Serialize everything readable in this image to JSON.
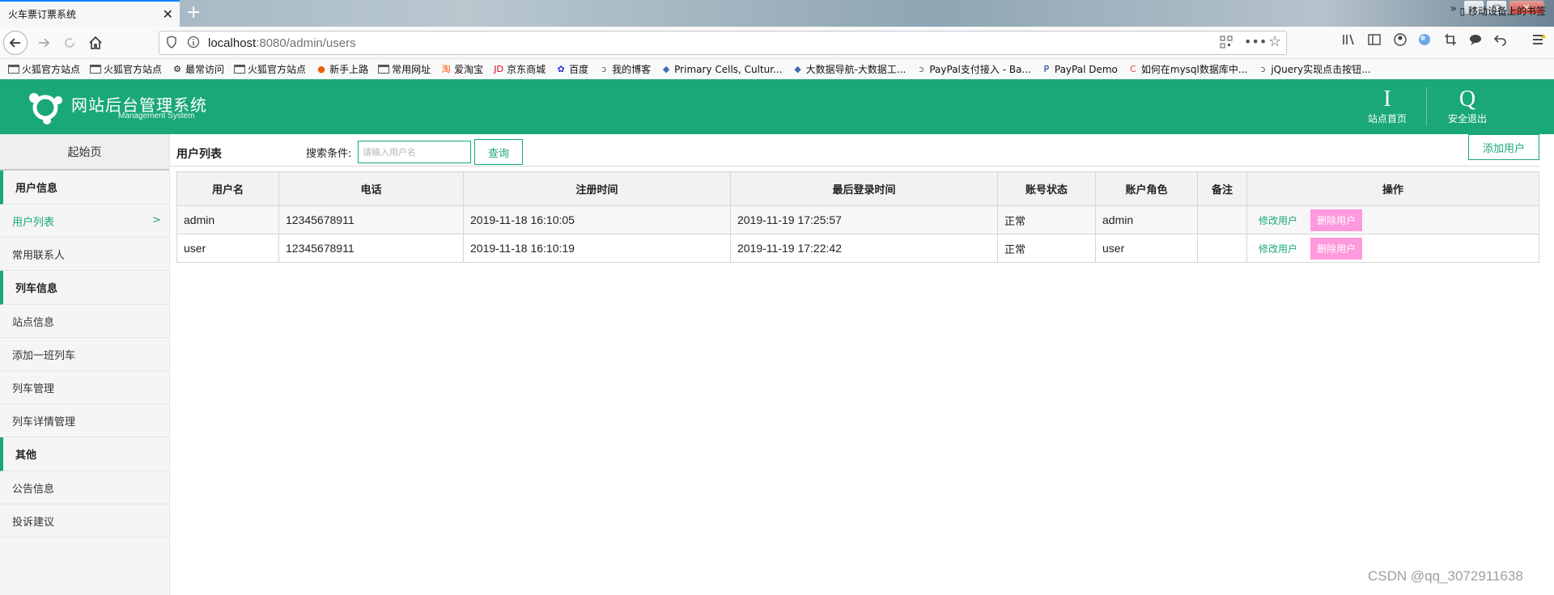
{
  "browser": {
    "tab_title": "火车票订票系统",
    "tab_close": "✕",
    "new_tab": "+",
    "url_host": "localhost",
    "url_rest": ":8080/admin/users",
    "win_min": "–",
    "win_max": "□",
    "win_close": "✕"
  },
  "bookmarks": [
    {
      "label": "火狐官方站点",
      "icon": "folder-icon"
    },
    {
      "label": "火狐官方站点",
      "icon": "folder-icon"
    },
    {
      "label": "最常访问",
      "icon": "gear-icon"
    },
    {
      "label": "火狐官方站点",
      "icon": "folder-icon"
    },
    {
      "label": "新手上路",
      "icon": "firefox-icon"
    },
    {
      "label": "常用网址",
      "icon": "folder-icon"
    },
    {
      "label": "爱淘宝",
      "icon": "taobao-icon"
    },
    {
      "label": "京东商城",
      "icon": "jd-icon"
    },
    {
      "label": "百度",
      "icon": "baidu-icon"
    },
    {
      "label": "我的博客",
      "icon": "blog-icon"
    },
    {
      "label": "Primary Cells, Cultur...",
      "icon": "site-icon"
    },
    {
      "label": "大数据导航-大数据工...",
      "icon": "site-icon"
    },
    {
      "label": "PayPal支付接入 - Ba...",
      "icon": "blog-icon"
    },
    {
      "label": "PayPal Demo",
      "icon": "paypal-icon"
    },
    {
      "label": "如何在mysql数据库中...",
      "icon": "csdn-icon"
    },
    {
      "label": "jQuery实现点击按钮...",
      "icon": "blog-icon"
    }
  ],
  "bookmarks_more": "»",
  "bookmarks_mobile": "移动设备上的书签",
  "header": {
    "title": "网站后台管理系统",
    "subtitle": "Management System",
    "home_icon": "I",
    "home_label": "站点首页",
    "logout_icon": "Q",
    "logout_label": "安全退出",
    "bg_color": "#1aa876"
  },
  "sidebar": {
    "home": "起始页",
    "sections": [
      {
        "title": "用户信息",
        "items": [
          "用户列表",
          "常用联系人"
        ]
      },
      {
        "title": "列车信息",
        "items": [
          "站点信息",
          "添加一班列车",
          "列车管理",
          "列车详情管理"
        ]
      },
      {
        "title": "其他",
        "items": [
          "公告信息",
          "投诉建议"
        ]
      }
    ],
    "active_arrow": ">"
  },
  "main": {
    "page_title": "用户列表",
    "search_label": "搜索条件:",
    "search_placeholder": "请输入用户名",
    "search_button": "查询",
    "add_button": "添加用户",
    "columns": [
      "用户名",
      "电话",
      "注册时间",
      "最后登录时间",
      "账号状态",
      "账户角色",
      "备注",
      "操作"
    ],
    "rows": [
      {
        "username": "admin",
        "phone": "12345678911",
        "registered": "2019-11-18 16:10:05",
        "last_login": "2019-11-19 17:25:57",
        "status": "正常",
        "role": "admin",
        "note": ""
      },
      {
        "username": "user",
        "phone": "12345678911",
        "registered": "2019-11-18 16:10:19",
        "last_login": "2019-11-19 17:22:42",
        "status": "正常",
        "role": "user",
        "note": ""
      }
    ],
    "edit_label": "修改用户",
    "delete_label": "删除用户"
  },
  "watermark": "CSDN @qq_3072911638"
}
